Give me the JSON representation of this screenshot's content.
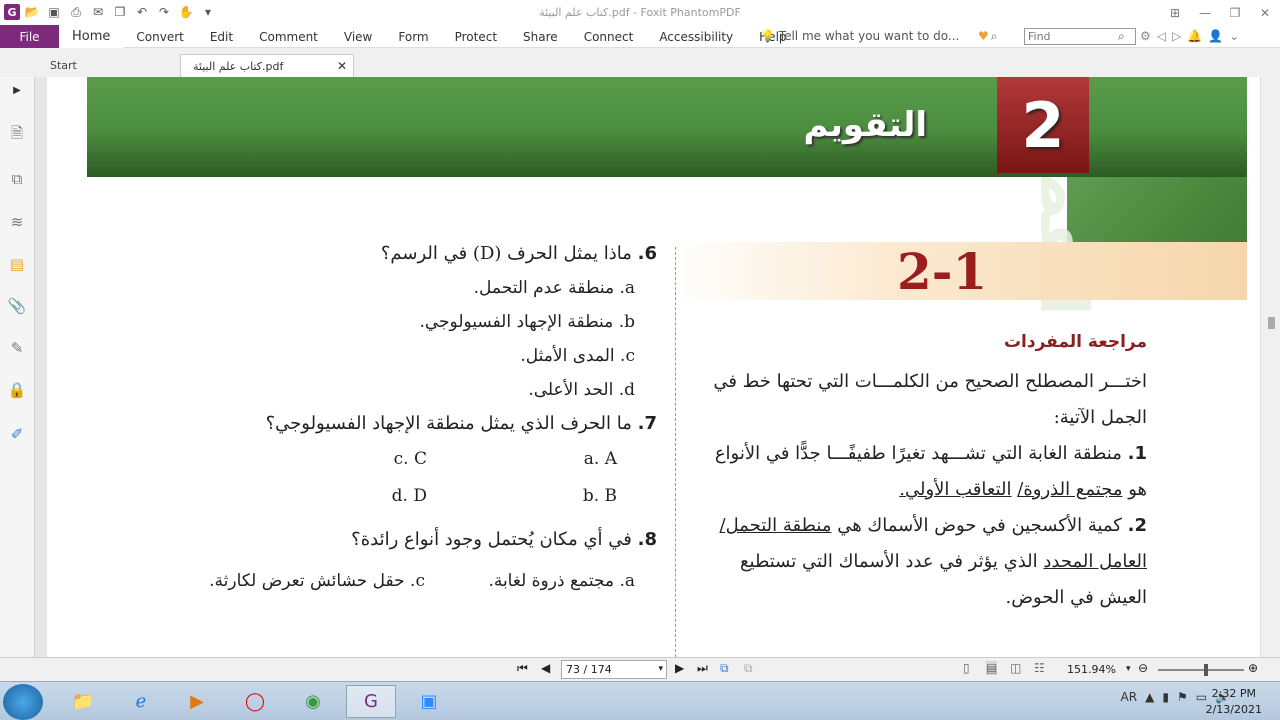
{
  "window": {
    "title": "كتاب علم البيئة.pdf - Foxit PhantomPDF"
  },
  "menu": {
    "file": "File",
    "items": [
      "Home",
      "Convert",
      "Edit",
      "Comment",
      "View",
      "Form",
      "Protect",
      "Share",
      "Connect",
      "Accessibility",
      "Help"
    ],
    "tell_me": "Tell me what you want to do...",
    "find_placeholder": "Find"
  },
  "tabs": {
    "start": "Start",
    "active": "كتاب علم البيئة.pdf"
  },
  "page": {
    "banner_title": "التقويم",
    "chapter_number": "2",
    "chapter_side": "الفصل",
    "lesson_number": "2-1",
    "vocab_heading": "مراجعة المفردات",
    "intro": "اختـــر المصطلح الصحيح من الكلمـــات التي تحتها خط في الجمل الآتية:",
    "q1_num": "1.",
    "q1_text": "منطقة الغابة التي تشـــهد تغيرًا طفيفًـــا جدًّا في الأنواع هو",
    "q1_opt1": "مجتمع الذروة/",
    "q1_opt2": "التعاقب الأولي.",
    "q2_num": "2.",
    "q2_text": "كمية الأكسجين في حوض الأسماك هي",
    "q2_opt1": "منطقة التحمل/",
    "q2_opt2": "العامل المحدد",
    "q2_rest": "الذي يؤثر في عدد الأسماك التي تستطيع العيش في الحوض.",
    "q6_num": "6.",
    "q6_text": "ماذا يمثل الحرف (D) في الرسم؟",
    "q6_options": [
      "a. منطقة عدم التحمل.",
      "b. منطقة الإجهاد الفسيولوجي.",
      "c. المدى الأمثل.",
      "d. الحد الأعلى."
    ],
    "q7_num": "7.",
    "q7_text": "ما الحرف الذي يمثل منطقة الإجهاد الفسيولوجي؟",
    "q7_options": [
      "a. A",
      "c. C",
      "b. B",
      "d. D"
    ],
    "q8_num": "8.",
    "q8_text": "في أي مكان يُحتمل وجود أنواع رائدة؟",
    "q8_opt_a": "a. مجتمع ذروة لغابة.",
    "q8_opt_c": "c. حقل حشائش تعرض لكارثة."
  },
  "navigation": {
    "page_field": "73 / 174",
    "zoom": "151.94%"
  },
  "taskbar": {
    "language": "AR",
    "time": "2:32 PM",
    "date": "2/13/2021"
  }
}
